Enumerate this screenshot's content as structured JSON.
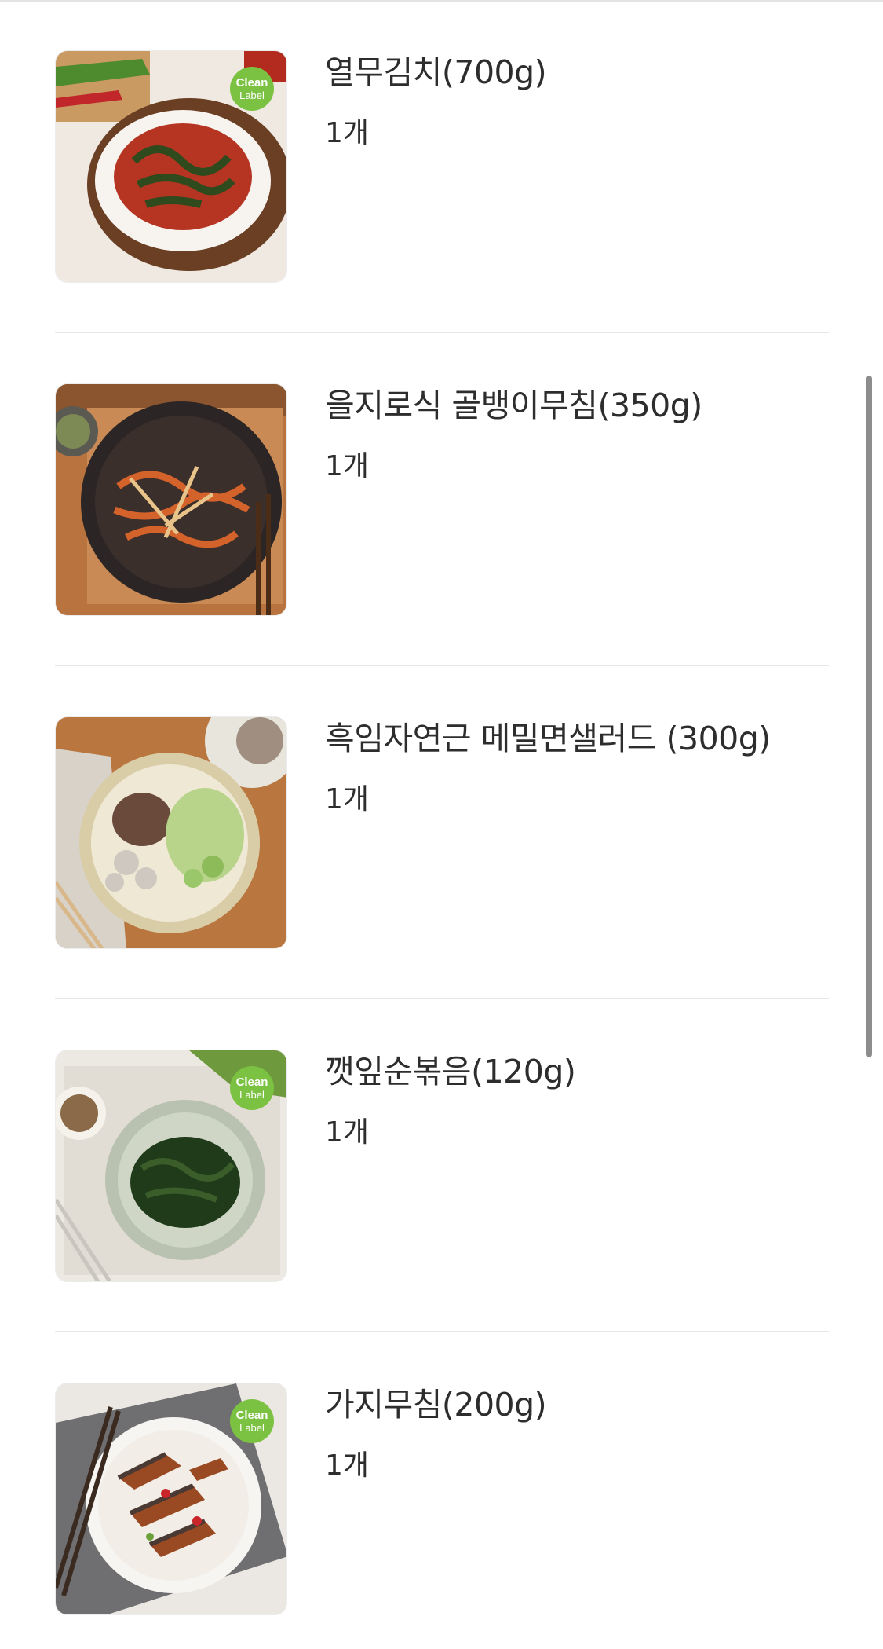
{
  "items": [
    {
      "title": "열무김치(700g)",
      "quantity": "1개",
      "clean_label": true,
      "badge_line1": "Clean",
      "badge_line2": "Label",
      "image": "yeolmu-kimchi-photo"
    },
    {
      "title": "을지로식 골뱅이무침(350g)",
      "quantity": "1개",
      "clean_label": false,
      "image": "golbaengi-muchim-photo"
    },
    {
      "title": "흑임자연근 메밀면샐러드 (300g)",
      "quantity": "1개",
      "clean_label": false,
      "image": "buckwheat-noodle-salad-photo"
    },
    {
      "title": "깻잎순볶음(120g)",
      "quantity": "1개",
      "clean_label": true,
      "badge_line1": "Clean",
      "badge_line2": "Label",
      "image": "perilla-sprout-stirfry-photo"
    },
    {
      "title": "가지무침(200g)",
      "quantity": "1개",
      "clean_label": true,
      "badge_line1": "Clean",
      "badge_line2": "Label",
      "image": "eggplant-muchim-photo"
    }
  ],
  "colors": {
    "badge": "#7cc242",
    "divider": "#e6e6e6",
    "text": "#2d2d2d",
    "scrollbar": "#8d8d8d"
  }
}
